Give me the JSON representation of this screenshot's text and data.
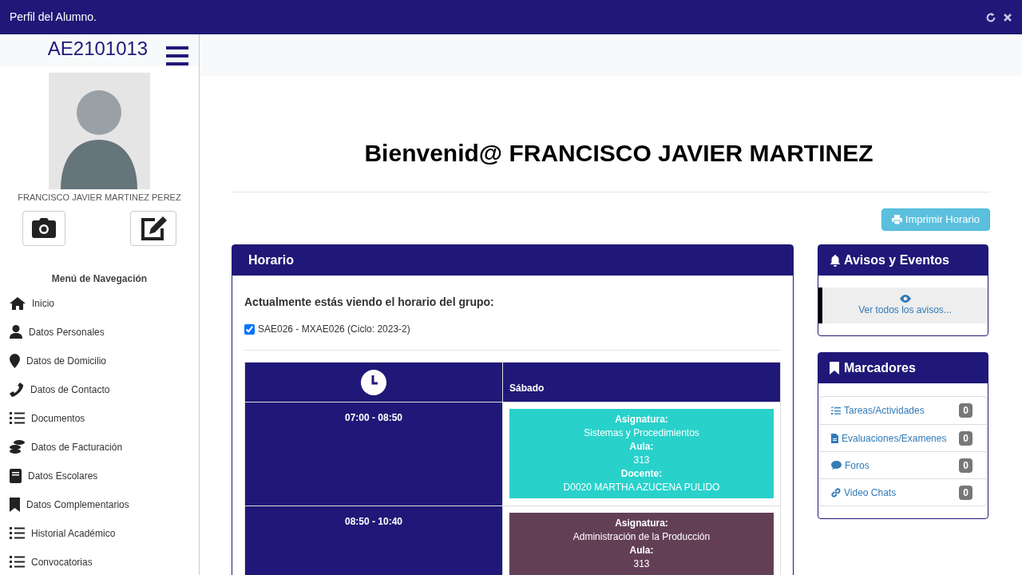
{
  "window": {
    "title": "Perfil del Alumno."
  },
  "sidebar": {
    "student_id": "AE2101013",
    "student_name": "FRANCISCO JAVIER MARTINEZ PEREZ",
    "menu_title": "Menú de Navegación",
    "items": [
      {
        "label": "Inicio",
        "kind": "home"
      },
      {
        "label": "Datos Personales",
        "kind": "user"
      },
      {
        "label": "Datos de Domicilio",
        "kind": "pin"
      },
      {
        "label": "Datos de Contacto",
        "kind": "phone"
      },
      {
        "label": "Documentos",
        "kind": "list"
      },
      {
        "label": "Datos de Facturación",
        "kind": "coins"
      },
      {
        "label": "Datos Escolares",
        "kind": "book"
      },
      {
        "label": "Datos Complementarios",
        "kind": "bookmark"
      },
      {
        "label": "Historial Académico",
        "kind": "list"
      },
      {
        "label": "Convocatorias",
        "kind": "list"
      }
    ]
  },
  "welcome": "Bienvenid@ FRANCISCO JAVIER MARTINEZ",
  "print_button": "Imprimir Horario",
  "schedule": {
    "title": "Horario",
    "intro": "Actualmente estás viendo el horario del grupo:",
    "group": {
      "label": "SAE026 - MXAE026 (Ciclo: 2023-2)",
      "checked": true
    },
    "day": "Sábado",
    "rows": [
      {
        "time": "07:00 - 08:50",
        "color": "#29d1cb",
        "lines": [
          {
            "kind": "label",
            "text": "Asignatura:"
          },
          {
            "kind": "value",
            "text": "Sistemas y Procedimientos"
          },
          {
            "kind": "label",
            "text": "Aula:"
          },
          {
            "kind": "value",
            "text": "313"
          },
          {
            "kind": "label",
            "text": "Docente:"
          },
          {
            "kind": "value",
            "text": "D0020 MARTHA AZUCENA PULIDO"
          }
        ]
      },
      {
        "time": "08:50 - 10:40",
        "color": "#633f56",
        "lines": [
          {
            "kind": "label",
            "text": "Asignatura:"
          },
          {
            "kind": "value",
            "text": "Administración de la Producción"
          },
          {
            "kind": "label",
            "text": "Aula:"
          },
          {
            "kind": "value",
            "text": "313"
          }
        ]
      }
    ]
  },
  "notices": {
    "title": "Avisos y Eventos",
    "link": "Ver todos los avisos..."
  },
  "bookmarks": {
    "title": "Marcadores",
    "items": [
      {
        "label": "Tareas/Actividades",
        "kind": "tasks",
        "count": "0"
      },
      {
        "label": "Evaluaciones/Examenes",
        "kind": "file",
        "count": "0"
      },
      {
        "label": "Foros",
        "kind": "chat",
        "count": "0"
      },
      {
        "label": "Video Chats",
        "kind": "link",
        "count": "0"
      }
    ]
  }
}
